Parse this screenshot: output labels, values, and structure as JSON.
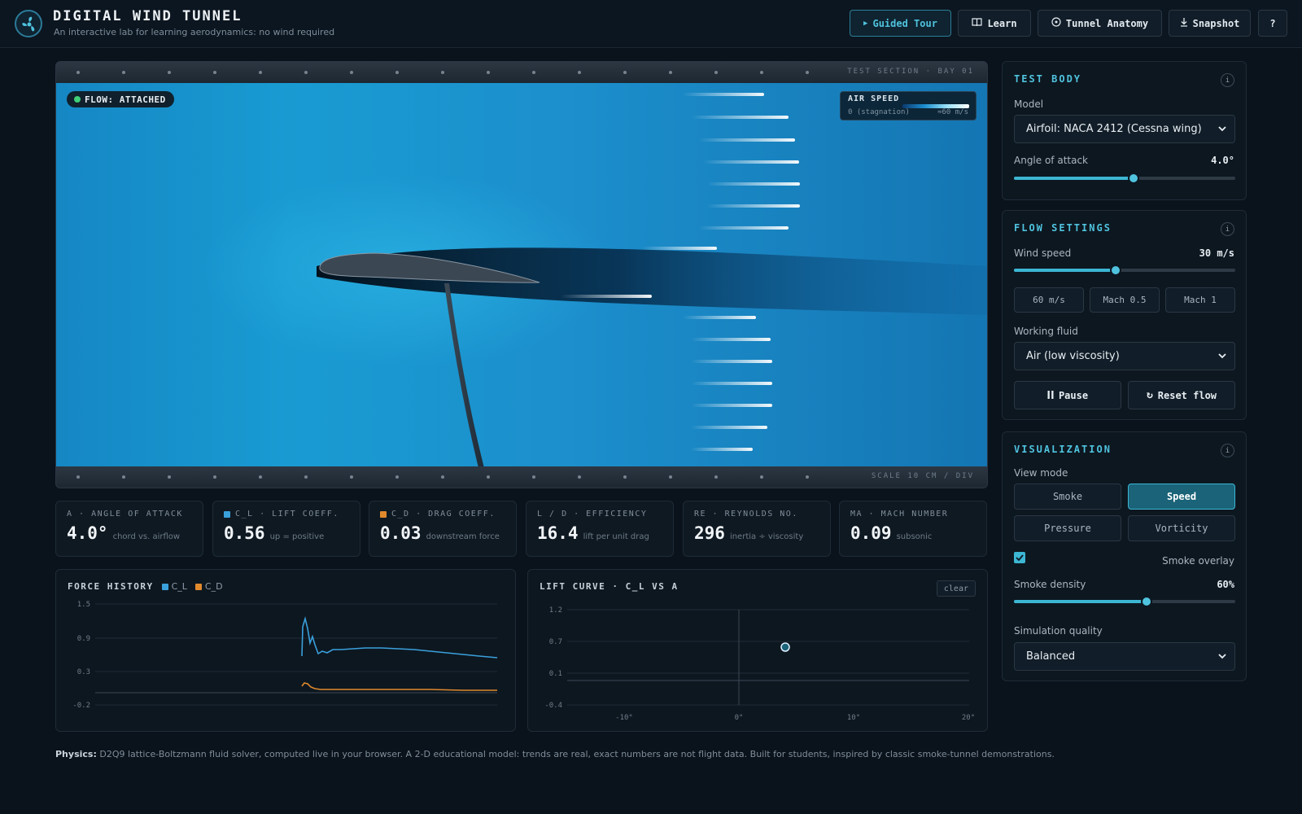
{
  "header": {
    "title": "DIGITAL WIND TUNNEL",
    "subtitle": "An interactive lab for learning aerodynamics: no wind required",
    "buttons": {
      "guided_tour": "Guided Tour",
      "learn": "Learn",
      "anatomy": "Tunnel Anatomy",
      "snapshot": "Snapshot",
      "help": "?"
    }
  },
  "tunnel": {
    "top_label": "TEST SECTION · BAY 01",
    "bottom_label": "SCALE 10 CM / DIV",
    "flow_status": "FLOW: ATTACHED",
    "airspeed": {
      "title": "AIR SPEED",
      "min": "0 (stagnation)",
      "max": "≈60 m/s"
    }
  },
  "stats": [
    {
      "label": "A · ANGLE OF ATTACK",
      "value": "4.0°",
      "note": "chord vs. airflow",
      "color": ""
    },
    {
      "label": "C_L · LIFT COEFF.",
      "value": "0.56",
      "note": "up = positive",
      "color": "#3aa0dc"
    },
    {
      "label": "C_D · DRAG COEFF.",
      "value": "0.03",
      "note": "downstream force",
      "color": "#e08a2c"
    },
    {
      "label": "L / D · EFFICIENCY",
      "value": "16.4",
      "note": "lift per unit drag",
      "color": ""
    },
    {
      "label": "RE · REYNOLDS NO.",
      "value": "296",
      "note": "inertia ÷ viscosity",
      "color": ""
    },
    {
      "label": "MA · MACH NUMBER",
      "value": "0.09",
      "note": "subsonic",
      "color": ""
    }
  ],
  "force_history": {
    "title": "FORCE HISTORY",
    "legend": [
      "C_L",
      "C_D"
    ],
    "y_ticks": [
      "1.5",
      "0.9",
      "0.3",
      "-0.2"
    ]
  },
  "lift_curve": {
    "title": "LIFT CURVE · C_L VS A",
    "clear_label": "clear",
    "y_ticks": [
      "1.2",
      "0.7",
      "0.1",
      "-0.4"
    ],
    "x_ticks": [
      "-10°",
      "0°",
      "10°",
      "20°"
    ]
  },
  "physics_note": {
    "label": "Physics:",
    "text": "D2Q9 lattice-Boltzmann fluid solver, computed live in your browser. A 2-D educational model: trends are real, exact numbers are not flight data. Built for students, inspired by classic smoke-tunnel demonstrations."
  },
  "test_body": {
    "title": "TEST BODY",
    "model_label": "Model",
    "model_value": "Airfoil: NACA 2412 (Cessna wing)",
    "aoa_label": "Angle of attack",
    "aoa_value": "4.0°",
    "aoa_fraction": 0.54
  },
  "flow_settings": {
    "title": "FLOW SETTINGS",
    "wind_label": "Wind speed",
    "wind_value": "30 m/s",
    "wind_fraction": 0.46,
    "presets": [
      "60 m/s",
      "Mach 0.5",
      "Mach 1"
    ],
    "fluid_label": "Working fluid",
    "fluid_value": "Air (low viscosity)",
    "pause_label": "Pause",
    "reset_label": "Reset flow"
  },
  "visualization": {
    "title": "VISUALIZATION",
    "view_mode_label": "View mode",
    "modes": [
      "Smoke",
      "Speed",
      "Pressure",
      "Vorticity"
    ],
    "active_mode": "Speed",
    "smoke_overlay_label": "Smoke overlay",
    "density_label": "Smoke density",
    "density_value": "60%",
    "density_fraction": 0.6,
    "quality_label": "Simulation quality",
    "quality_value": "Balanced"
  },
  "colors": {
    "accent": "#4fc3de",
    "lift": "#3aa0dc",
    "drag": "#e08a2c",
    "status_ok": "#3fcf78"
  },
  "icons": {
    "logo": "fan-icon",
    "guided_tour": "play-icon",
    "learn": "book-icon",
    "anatomy": "target-icon",
    "snapshot": "download-icon",
    "pause": "pause-icon",
    "reset": "refresh-icon"
  }
}
